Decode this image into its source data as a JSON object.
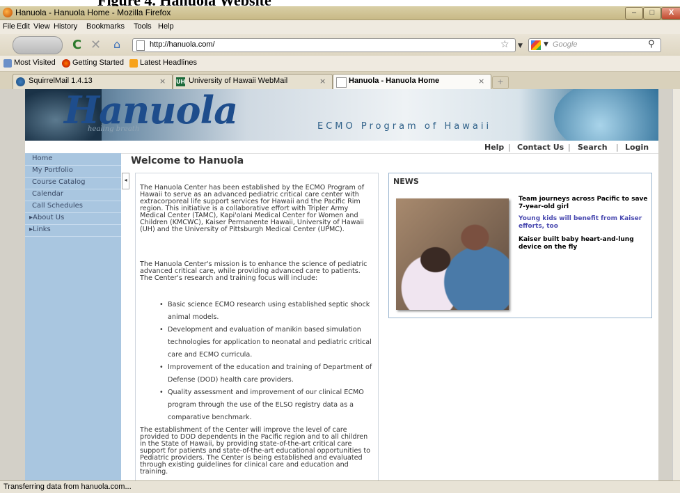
{
  "caption": "Figure 4. Hanuola Website",
  "window": {
    "title": "Hanuola - Hanuola Home - Mozilla Firefox",
    "minimize": "–",
    "maximize": "□",
    "close": "X"
  },
  "menu": [
    "File",
    "Edit",
    "View",
    "History",
    "Bookmarks",
    "Tools",
    "Help"
  ],
  "nav": {
    "url": "http://hanuola.com/",
    "search_placeholder": "Google"
  },
  "bookmarks": [
    "Most Visited",
    "Getting Started",
    "Latest Headlines"
  ],
  "tabs": [
    {
      "label": "SquirrelMail 1.4.13",
      "active": false
    },
    {
      "label": "University of Hawaii WebMail",
      "active": false
    },
    {
      "label": "Hanuola - Hanuola Home",
      "active": true
    }
  ],
  "site": {
    "logo": "Hanuola",
    "tagline": "healing breath",
    "program": "ECMO Program of Hawaii",
    "topnav": [
      "Help",
      "Contact Us",
      "Search",
      "Login"
    ],
    "sidebar": [
      {
        "label": "Home",
        "expandable": false
      },
      {
        "label": "My Portfolio",
        "expandable": false
      },
      {
        "label": "Course Catalog",
        "expandable": false
      },
      {
        "label": "Calendar",
        "expandable": false
      },
      {
        "label": "Call Schedules",
        "expandable": false
      },
      {
        "label": "About Us",
        "expandable": true
      },
      {
        "label": "Links",
        "expandable": true
      }
    ],
    "welcome": "Welcome to Hanuola",
    "paragraphs": [
      "The Hanuola Center has been established by the ECMO Program of Hawaii to serve as an advanced pediatric critical care center with extracorporeal life support services for Hawaii and the Pacific Rim region. This initiative is a collaborative effort with Tripler Army Medical Center (TAMC), Kapi'olani Medical Center for Women and Children (KMCWC), Kaiser Permanente Hawaii, University of Hawaii (UH) and the University of Pittsburgh Medical Center (UPMC).",
      "The Hanuola Center's mission is to enhance the science of pediatric advanced critical care, while providing advanced care to patients. The Center's research and training focus will include:",
      "The establishment of the Center will improve the level of care provided to DOD dependents in the Pacific region and to all children in the State of Hawaii, by providing state-of-the-art critical care support for patients and state-of-the-art educational opportunities to Pediatric providers. The Center is being established and evaluated through existing guidelines for clinical care and education and training."
    ],
    "bullets": [
      "Basic science ECMO research using established septic shock animal models.",
      "Development and evaluation of manikin based simulation technologies for application to neonatal and pediatric critical care and ECMO curricula.",
      "Improvement of the education and training of Department of Defense (DOD) health care providers.",
      "Quality assessment and improvement of our clinical ECMO program through the use of the ELSO registry data as a comparative benchmark."
    ],
    "news": {
      "title": "NEWS",
      "items": [
        {
          "text": "Team journeys across Pacific to save 7-year-old girl",
          "color": "#000000"
        },
        {
          "text": "Young kids will benefit from Kaiser efforts, too",
          "color": "#4a4ab0"
        },
        {
          "text": "Kaiser built baby heart-and-lung device on the fly",
          "color": "#000000"
        }
      ]
    }
  },
  "status": "Transferring data from hanuola.com..."
}
